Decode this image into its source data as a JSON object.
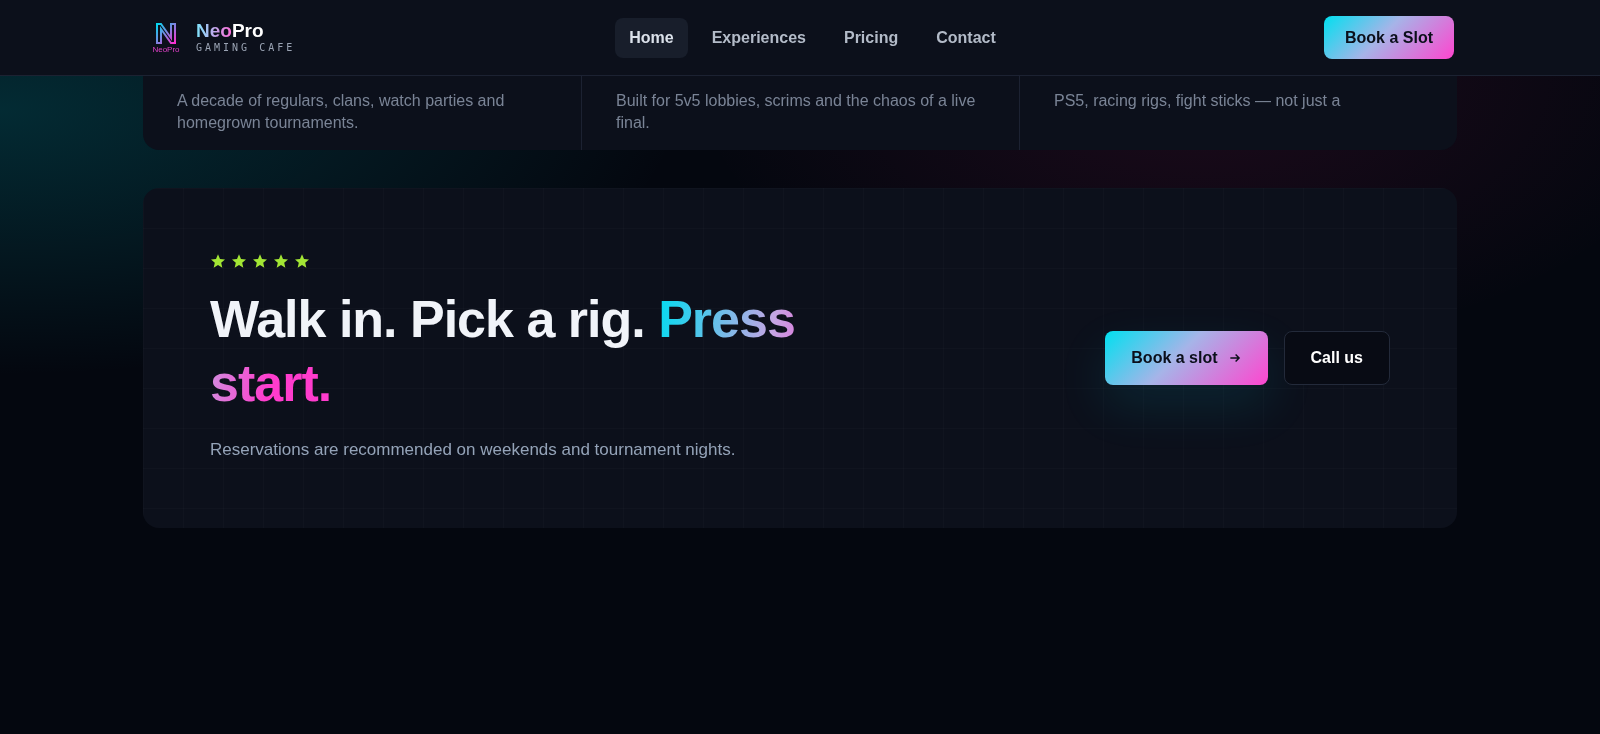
{
  "features": [
    {
      "text": "A decade of regulars, clans, watch parties and homegrown tournaments."
    },
    {
      "text": "Built for 5v5 lobbies, scrims and the chaos of a live final."
    },
    {
      "text": "PS5, racing rigs, fight sticks — not just a"
    }
  ],
  "header": {
    "logo_mark": "NeoPro",
    "brand_first": "Neo",
    "brand_second": "Pro",
    "tagline": "GAMING CAFE",
    "nav": [
      {
        "label": "Home",
        "selected": true
      },
      {
        "label": "Experiences",
        "selected": false
      },
      {
        "label": "Pricing",
        "selected": false
      },
      {
        "label": "Contact",
        "selected": false
      }
    ],
    "cta": "Book a Slot"
  },
  "cta_card": {
    "stars": 5,
    "headline_plain": "Walk in. Pick a rig.",
    "headline_highlight": "Press start.",
    "note": "Reservations are recommended on weekends and tournament nights.",
    "primary_button": "Book a slot",
    "secondary_button": "Call us"
  }
}
